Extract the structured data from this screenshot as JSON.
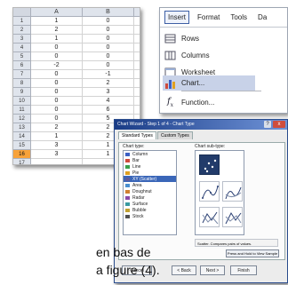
{
  "sheet": {
    "columns": [
      "",
      "A",
      "B",
      ""
    ],
    "rows": [
      {
        "n": "1",
        "a": "1",
        "b": "0"
      },
      {
        "n": "2",
        "a": "2",
        "b": "0"
      },
      {
        "n": "3",
        "a": "1",
        "b": "0"
      },
      {
        "n": "4",
        "a": "0",
        "b": "0"
      },
      {
        "n": "5",
        "a": "0",
        "b": "0"
      },
      {
        "n": "6",
        "a": "-2",
        "b": "0"
      },
      {
        "n": "7",
        "a": "0",
        "b": "-1"
      },
      {
        "n": "8",
        "a": "0",
        "b": "2"
      },
      {
        "n": "9",
        "a": "0",
        "b": "3"
      },
      {
        "n": "10",
        "a": "0",
        "b": "4"
      },
      {
        "n": "11",
        "a": "0",
        "b": "6"
      },
      {
        "n": "12",
        "a": "0",
        "b": "5"
      },
      {
        "n": "13",
        "a": "2",
        "b": "2"
      },
      {
        "n": "14",
        "a": "1",
        "b": "2"
      },
      {
        "n": "15",
        "a": "3",
        "b": "1"
      },
      {
        "n": "16",
        "a": "3",
        "b": "1"
      },
      {
        "n": "17",
        "a": "",
        "b": ""
      }
    ],
    "selected_row": "16"
  },
  "menu": {
    "bar": [
      "Insert",
      "Format",
      "Tools",
      "Da"
    ],
    "items": [
      {
        "label": "Rows",
        "icon": "rows-icon"
      },
      {
        "label": "Columns",
        "icon": "columns-icon"
      },
      {
        "label": "Worksheet",
        "icon": "worksheet-icon"
      },
      {
        "label": "Chart...",
        "icon": "chart-icon"
      },
      {
        "label": "Function...",
        "icon": "function-icon"
      }
    ]
  },
  "wizard": {
    "title": "Chart Wizard - Step 1 of 4 - Chart Type",
    "tabs": [
      "Standard Types",
      "Custom Types"
    ],
    "chart_type_label": "Chart type:",
    "subtype_label": "Chart sub-type:",
    "types": [
      {
        "label": "Column",
        "color": "#3b5fc4"
      },
      {
        "label": "Bar",
        "color": "#d04b3b"
      },
      {
        "label": "Line",
        "color": "#3aa04b"
      },
      {
        "label": "Pie",
        "color": "#e0a020"
      },
      {
        "label": "XY (Scatter)",
        "color": "#5b5b9b"
      },
      {
        "label": "Area",
        "color": "#4a8fcf"
      },
      {
        "label": "Doughnut",
        "color": "#d08030"
      },
      {
        "label": "Radar",
        "color": "#8a4aa8"
      },
      {
        "label": "Surface",
        "color": "#3a9aa0"
      },
      {
        "label": "Bubble",
        "color": "#c0a030"
      },
      {
        "label": "Stock",
        "color": "#505050"
      }
    ],
    "selected_type": "XY (Scatter)",
    "description": "Scatter. Compares pairs of values.",
    "press_button": "Press and Hold to View Sample",
    "buttons": [
      "Cancel",
      "< Back",
      "Next >",
      "Finish"
    ],
    "help": "?",
    "close": "x"
  },
  "caption": {
    "line1": "en bas de",
    "line2": "a figure (4)."
  },
  "colors": {
    "row_selected": "#f7a23a",
    "menu_highlight": "#c8d2e8",
    "title_bar": "#1a3c86"
  }
}
